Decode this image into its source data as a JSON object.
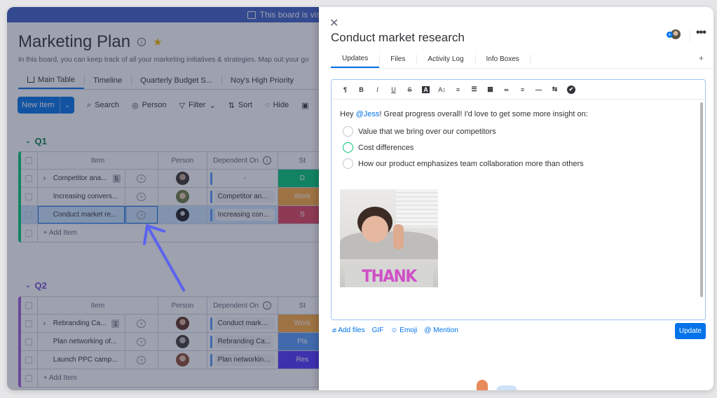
{
  "board": {
    "banner_text": "This board is visi",
    "title": "Marketing Plan",
    "description": "In this board, you can keep track of all your marketing initiatives & strategies. Map out your go",
    "view_tabs": [
      "Main Table",
      "Timeline",
      "Quarterly Budget S...",
      "Noy's High Priority"
    ],
    "toolbar": {
      "new_item": "New Item",
      "search": "Search",
      "person": "Person",
      "filter": "Filter",
      "sort": "Sort",
      "hide": "Hide"
    },
    "columns": {
      "item": "Item",
      "person": "Person",
      "dependent_on": "Dependent On",
      "status": "St"
    },
    "add_item": "+ Add Item",
    "groups": [
      {
        "name": "Q1",
        "color": "#00c875",
        "rows": [
          {
            "item": "Competitor ana...",
            "subitems": "5",
            "dependent_on": "-",
            "status": "D",
            "status_color": "#00c875"
          },
          {
            "item": "Increasing convers...",
            "subitems": null,
            "dependent_on": "Competitor anal...",
            "status": "Work",
            "status_color": "#fdab3d"
          },
          {
            "item": "Conduct market re...",
            "subitems": null,
            "dependent_on": "Increasing conv...",
            "status": "S",
            "status_color": "#e2445c"
          }
        ]
      },
      {
        "name": "Q2",
        "color": "#a25ddc",
        "rows": [
          {
            "item": "Rebranding Ca...",
            "subitems": "1",
            "dependent_on": "Conduct market...",
            "status": "Work",
            "status_color": "#fdab3d"
          },
          {
            "item": "Plan networking of...",
            "subitems": null,
            "dependent_on": "Rebranding Ca...",
            "status": "Pla",
            "status_color": "#579bfc"
          },
          {
            "item": "Launch PPC camp...",
            "subitems": null,
            "dependent_on": "Plan networking...",
            "status": "Res",
            "status_color": "#5034ff"
          }
        ]
      }
    ]
  },
  "panel": {
    "title": "Conduct market research",
    "tabs": [
      "Updates",
      "Files",
      "Activity Log",
      "Info Boxes"
    ],
    "tab_add": "+",
    "more": "•••",
    "editor": {
      "toolbar": [
        "¶",
        "B",
        "I",
        "U",
        "S",
        "A",
        "A↕",
        "≡",
        "☰",
        "▦",
        "∞",
        "≡",
        "—",
        "⇆",
        "✔"
      ],
      "message_prefix": "Hey ",
      "mention": "@Jess",
      "message_suffix": "! Great progress overall! I'd love to get some more insight on:",
      "checklist": [
        "Value that we bring over our competitors",
        "Cost differences",
        "How our product emphasizes team collaboration more than others"
      ],
      "gif_caption": "THANK YOU!"
    },
    "actions": {
      "add_files": "Add files",
      "gif": "GIF",
      "emoji": "Emoji",
      "mention": "Mention"
    },
    "update_button": "Update"
  }
}
